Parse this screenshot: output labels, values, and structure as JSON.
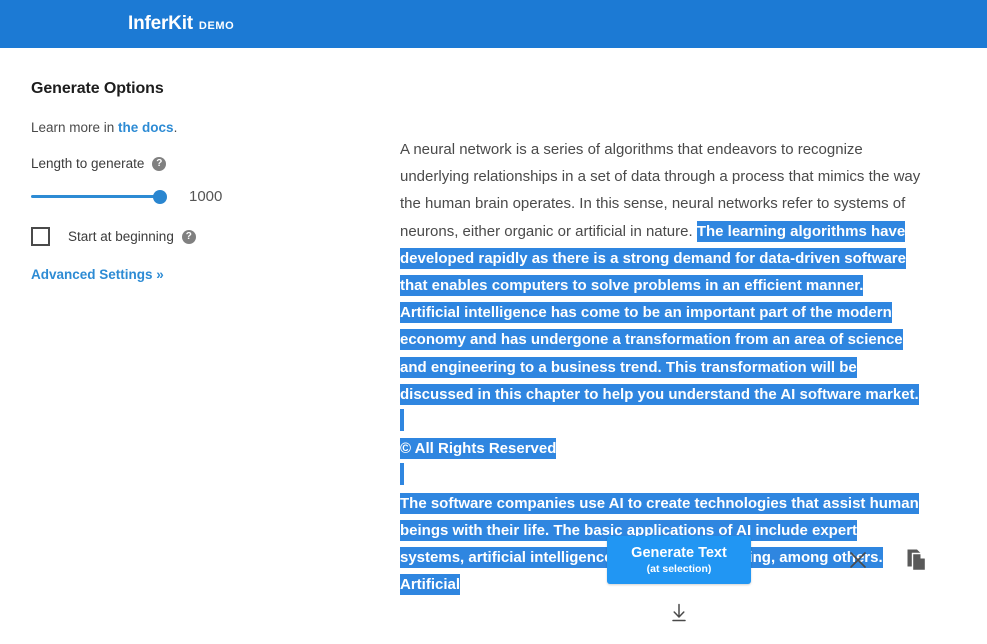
{
  "header": {
    "brand_name": "InferKit",
    "brand_tag": "DEMO",
    "background_color": "#1c7ad4"
  },
  "sidebar": {
    "panel_title": "Generate Options",
    "learn_more_prefix": "Learn more in ",
    "learn_more_link": "the docs",
    "learn_more_suffix": ".",
    "length_label": "Length to generate",
    "length_help_icon": "help-icon",
    "length_value": "1000",
    "slider": {
      "value": 1000,
      "fill_color": "#2d8bd4",
      "thumb_color": "#2a86d0"
    },
    "start_at_beginning_label": "Start at beginning",
    "start_at_beginning_checked": false,
    "start_help_icon": "help-icon",
    "advanced_settings_label": "Advanced Settings »"
  },
  "editor": {
    "paragraph_1_plain": "A neural network is a series of algorithms that endeavors to recognize underlying relationships in a set of data through a process that mimics the way the human brain operates. In this sense, neural networks refer to systems of neurons, either organic or artificial in nature. ",
    "paragraph_1_selected": "The learning algorithms have developed rapidly as there is a strong demand for data-driven software that enables computers to solve problems in an efficient manner. Artificial intelligence has come to be an important part of the modern economy and has undergone a transformation from an area of science and engineering to a business trend. This transformation will be discussed in this chapter to help you understand the AI software market.",
    "paragraph_2_selected": "© All Rights Reserved",
    "paragraph_3_selected": "The software companies use AI to create technologies that assist human beings with their life. The basic applications of AI include expert systems, artificial intelligence and machine learning, among others. Artificial",
    "selection_color": "#2f86e0"
  },
  "actions": {
    "generate_label": "Generate Text",
    "generate_sublabel": "(at selection)",
    "generate_color": "#2196f3",
    "close_icon": "close-icon",
    "copy_icon": "copy-icon",
    "download_icon": "download-icon"
  }
}
